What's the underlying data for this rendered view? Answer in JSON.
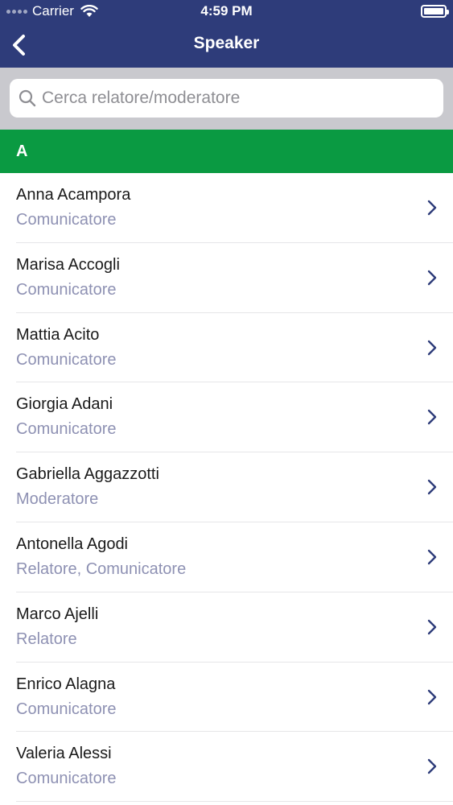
{
  "status_bar": {
    "carrier": "Carrier",
    "time": "4:59 PM"
  },
  "nav": {
    "title": "Speaker",
    "back_icon": "chevron-left-icon"
  },
  "search": {
    "placeholder": "Cerca relatore/moderatore",
    "value": ""
  },
  "section": {
    "letter": "A"
  },
  "speakers": [
    {
      "name": "Anna Acampora",
      "role": "Comunicatore"
    },
    {
      "name": "Marisa Accogli",
      "role": "Comunicatore"
    },
    {
      "name": "Mattia Acito",
      "role": "Comunicatore"
    },
    {
      "name": "Giorgia Adani",
      "role": "Comunicatore"
    },
    {
      "name": "Gabriella Aggazzotti",
      "role": "Moderatore"
    },
    {
      "name": "Antonella Agodi",
      "role": "Relatore, Comunicatore"
    },
    {
      "name": "Marco Ajelli",
      "role": "Relatore"
    },
    {
      "name": "Enrico Alagna",
      "role": "Comunicatore"
    },
    {
      "name": "Valeria Alessi",
      "role": "Comunicatore"
    }
  ],
  "colors": {
    "header": "#2e3c7a",
    "section": "#0a9a42",
    "role_text": "#8e91b3",
    "chevron": "#2e3c7a"
  }
}
